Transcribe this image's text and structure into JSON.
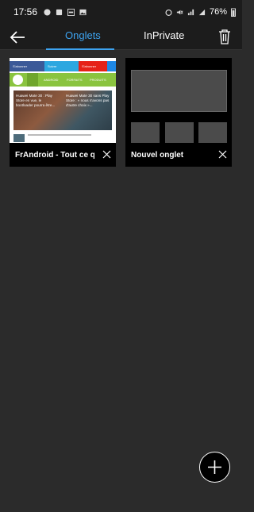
{
  "status_bar": {
    "time": "17:56",
    "battery_percent": "76%"
  },
  "tabs": {
    "onglets_label": "Onglets",
    "inprivate_label": "InPrivate"
  },
  "open_tabs": [
    {
      "title": "FrAndroid - Tout ce qu'i",
      "preview": {
        "social": [
          "S'abonner",
          "Suivre",
          "S'abonner"
        ],
        "nav": [
          "ANDROID",
          "FORFAITS",
          "PRODUITS"
        ],
        "headline_left": "Huawei Mate 30 : Play Store en vue, le bootloader pourra être...",
        "headline_right": "Huawei Mate 30 sans Play Store : « nous n'avons pas d'autre choix »..."
      }
    },
    {
      "title": "Nouvel onglet"
    }
  ],
  "colors": {
    "accent": "#3da3f0",
    "background": "#2b2b2b",
    "bar": "#1c1c1c"
  },
  "icons": {
    "back": "arrow-left-icon",
    "delete": "trash-icon",
    "close": "close-icon",
    "add": "plus-icon"
  }
}
